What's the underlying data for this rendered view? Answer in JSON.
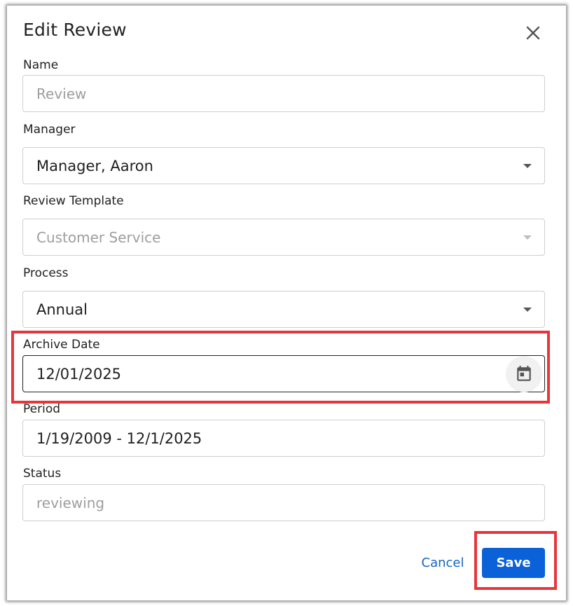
{
  "dialog": {
    "title": "Edit Review",
    "close_icon": "close-icon"
  },
  "fields": {
    "name": {
      "label": "Name",
      "placeholder": "Review"
    },
    "manager": {
      "label": "Manager",
      "value": "Manager, Aaron",
      "icon": "chevron-down-icon"
    },
    "review_template": {
      "label": "Review Template",
      "value": "Customer Service",
      "disabled": true,
      "icon": "chevron-down-icon"
    },
    "process": {
      "label": "Process",
      "value": "Annual",
      "icon": "chevron-down-icon"
    },
    "archive_date": {
      "label": "Archive Date",
      "value": "12/01/2025",
      "icon": "calendar-icon"
    },
    "period": {
      "label": "Period",
      "value": "1/19/2009 - 12/1/2025"
    },
    "status": {
      "label": "Status",
      "value": "reviewing",
      "disabled": true
    }
  },
  "actions": {
    "cancel_label": "Cancel",
    "save_label": "Save"
  },
  "colors": {
    "accent": "#0b61d8",
    "link": "#1565c0",
    "highlight": "#e5363b"
  }
}
